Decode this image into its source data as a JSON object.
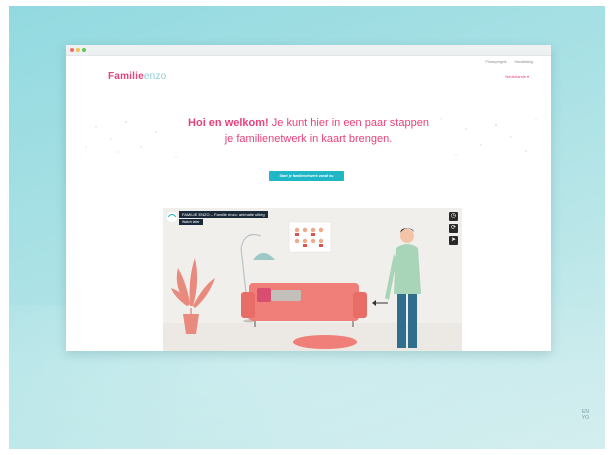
{
  "browser": {
    "nav_links": [
      "Privacyregels",
      "Handleiding"
    ]
  },
  "site": {
    "logo_primary": "Familie",
    "logo_secondary": "enzo",
    "language": "Nederlands ▾"
  },
  "hero": {
    "headline_bold": "Hoi en welkom!",
    "headline_rest_line1": " Je kunt hier in een paar stappen",
    "headline_line2": "je familienetwerk in kaart brengen.",
    "cta_label": "Start je familienetwerk vanaf nu"
  },
  "video": {
    "title": "FAMILIE ENZO – Familie enzo: animatie uitleg",
    "subtitle": "Watch later",
    "icons": [
      "watch-later-icon",
      "share-icon",
      "send-icon"
    ]
  },
  "corner_mark": "EN\nYO",
  "colors": {
    "brand_pink": "#e8417c",
    "brand_teal": "#1fb6c6",
    "background_teal": "#a6e0e4"
  }
}
